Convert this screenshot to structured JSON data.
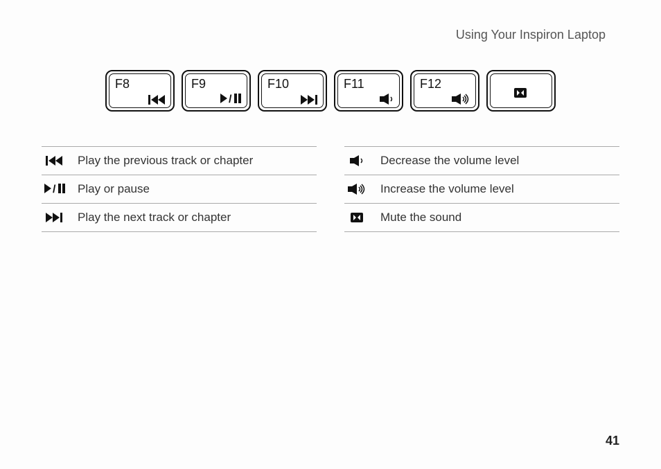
{
  "header": {
    "title": "Using Your Inspiron Laptop"
  },
  "keys": [
    {
      "label": "F8",
      "icon": "prev-track-icon"
    },
    {
      "label": "F9",
      "icon": "play-pause-icon"
    },
    {
      "label": "F10",
      "icon": "next-track-icon"
    },
    {
      "label": "F11",
      "icon": "volume-down-icon"
    },
    {
      "label": "F12",
      "icon": "volume-up-icon"
    },
    {
      "label": "",
      "icon": "mute-icon"
    }
  ],
  "legend": {
    "left": [
      {
        "icon": "prev-track-icon",
        "text": "Play the previous track or chapter"
      },
      {
        "icon": "play-pause-icon",
        "text": "Play or pause"
      },
      {
        "icon": "next-track-icon",
        "text": "Play the next track or chapter"
      }
    ],
    "right": [
      {
        "icon": "volume-down-icon",
        "text": "Decrease the volume level"
      },
      {
        "icon": "volume-up-icon",
        "text": "Increase the volume level"
      },
      {
        "icon": "mute-icon",
        "text": "Mute the sound"
      }
    ]
  },
  "page_number": "41"
}
